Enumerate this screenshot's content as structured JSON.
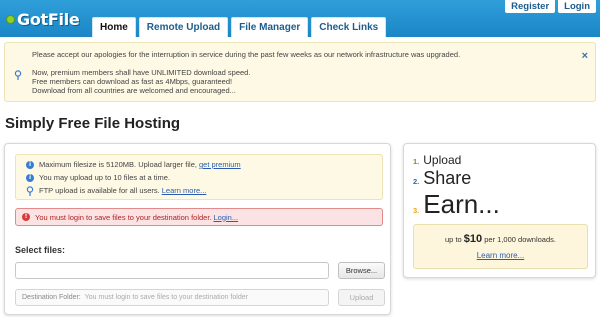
{
  "header": {
    "logo": "GotFile",
    "nav": [
      "Home",
      "Remote Upload",
      "File Manager",
      "Check Links"
    ],
    "auth": [
      "Register",
      "Login"
    ],
    "colors": {
      "header": "#1b86c6",
      "logo_dot": "#8dd12b"
    }
  },
  "notice": {
    "line1": "Please accept our apologies for the interruption in service during the past few weeks as our network infrastructure was upgraded.",
    "line2": "Now, premium members shall have UNLIMITED download speed.",
    "line3": "Free members can download as fast as 4Mbps, guaranteed!",
    "line4": "Download from all countries are welcomed and encouraged...",
    "close": "×"
  },
  "page_title": "Simply Free File Hosting",
  "upload": {
    "info": [
      {
        "text": "Maximum filesize is 5120MB. Upload larger file,",
        "link": "get premium"
      },
      {
        "text": "You may upload up to 10 files at a time.",
        "link": ""
      },
      {
        "text": "FTP upload is available for all users.",
        "link": "Learn more..."
      }
    ],
    "warning": {
      "text": "You must login to save files to your destination folder.",
      "link": "Login..."
    },
    "select_label": "Select files:",
    "browse": "Browse...",
    "dest_label": "Destination Folder:",
    "dest_placeholder": "You must login to save files to your destination folder",
    "upload_button": "Upload"
  },
  "steps": [
    {
      "num": "1.",
      "text": "Upload",
      "color": "#5aa02c"
    },
    {
      "num": "2.",
      "text": "Share",
      "color": "#2a6bb5"
    },
    {
      "num": "3.",
      "text": "Earn...",
      "color": "#e6a817"
    }
  ],
  "promo": {
    "prefix": "up to",
    "amount": "$10",
    "suffix": "per 1,000 downloads.",
    "link": "Learn more..."
  }
}
